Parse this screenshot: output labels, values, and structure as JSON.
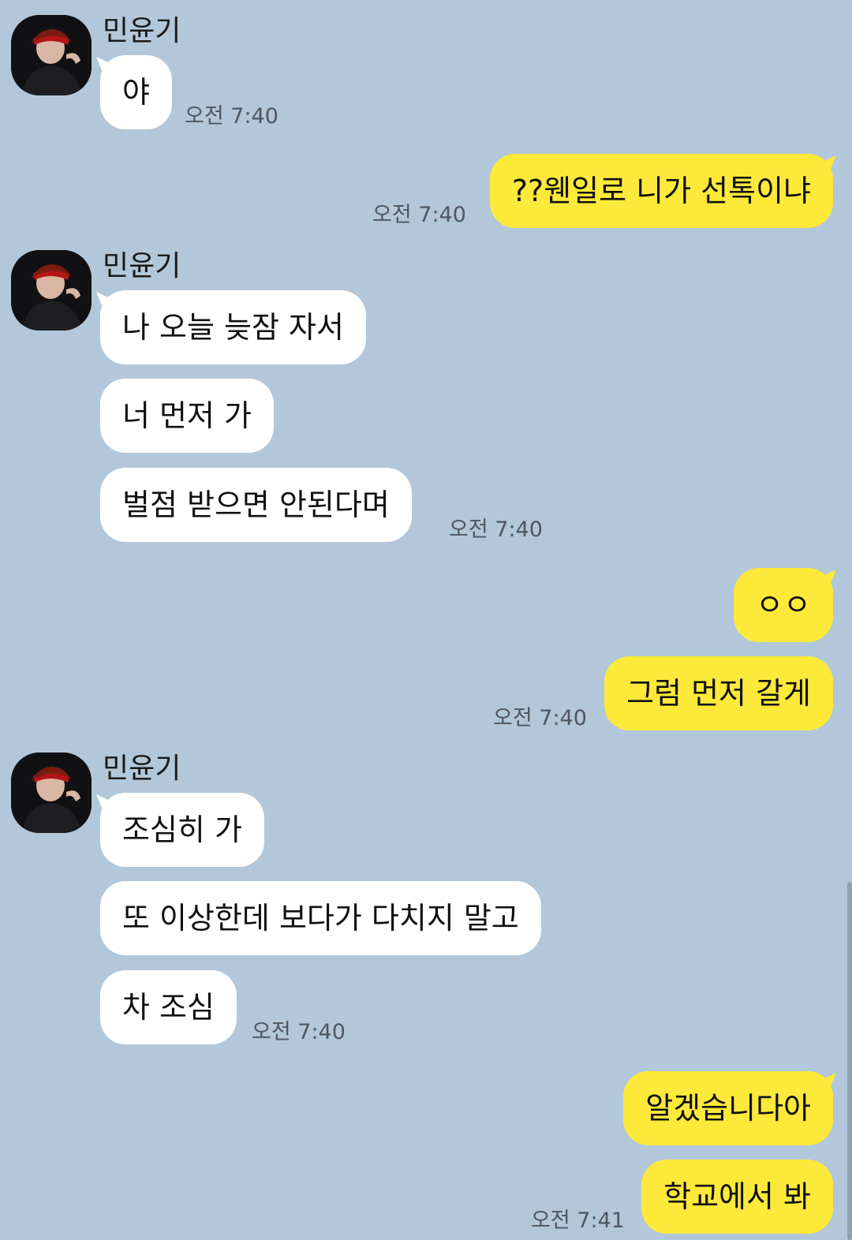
{
  "chat": {
    "contact_name": "민윤기",
    "groups": [
      {
        "side": "in",
        "sender": "민윤기",
        "messages": [
          "야"
        ],
        "time": "오전 7:40"
      },
      {
        "side": "out",
        "messages": [
          "??웬일로 니가 선톡이냐"
        ],
        "time": "오전 7:40"
      },
      {
        "side": "in",
        "sender": "민윤기",
        "messages": [
          "나 오늘 늦잠 자서",
          "너 먼저 가",
          "벌점 받으면 안된다며"
        ],
        "time": "오전 7:40"
      },
      {
        "side": "out",
        "messages": [
          "ㅇㅇ",
          "그럼 먼저 갈게"
        ],
        "time": "오전 7:40"
      },
      {
        "side": "in",
        "sender": "민윤기",
        "messages": [
          "조심히 가",
          "또 이상한데 보다가 다치지 말고",
          "차 조심"
        ],
        "time": "오전 7:40"
      },
      {
        "side": "out",
        "messages": [
          "알겠습니다아",
          "학교에서 봐"
        ],
        "time": "오전 7:41"
      }
    ]
  },
  "colors": {
    "background": "#b2c7da",
    "incoming_bubble": "#ffffff",
    "outgoing_bubble": "#fde93a",
    "timestamp": "#4f5660"
  },
  "icons": {
    "avatar": "profile-photo"
  }
}
